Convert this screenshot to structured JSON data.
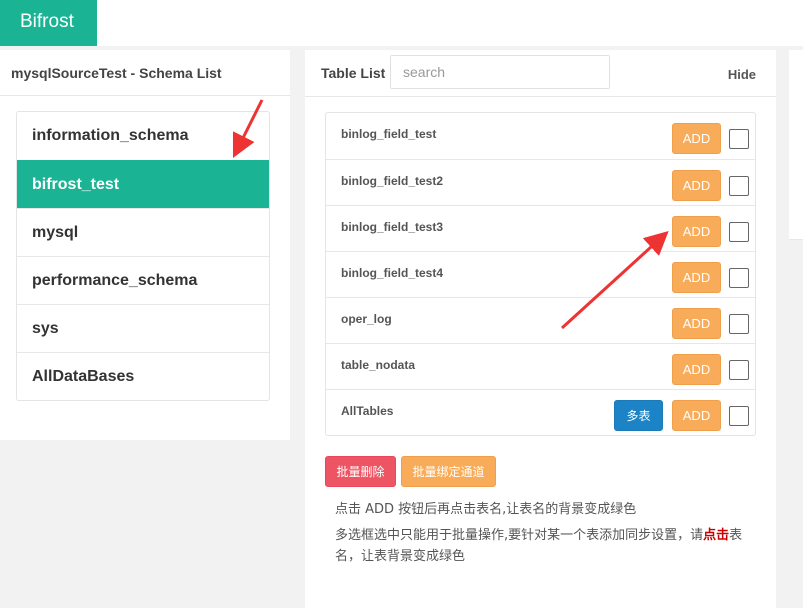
{
  "app": {
    "brand": "Bifrost"
  },
  "schema_panel": {
    "title": "mysqlSourceTest - Schema List",
    "items": [
      {
        "label": "information_schema",
        "active": false
      },
      {
        "label": "bifrost_test",
        "active": true
      },
      {
        "label": "mysql",
        "active": false
      },
      {
        "label": "performance_schema",
        "active": false
      },
      {
        "label": "sys",
        "active": false
      },
      {
        "label": "AllDataBases",
        "active": false
      }
    ]
  },
  "table_panel": {
    "title": "Table List",
    "search_placeholder": "search",
    "hide_label": "Hide",
    "add_label": "ADD",
    "multi_label": "多表",
    "rows": [
      {
        "name": "binlog_field_test"
      },
      {
        "name": "binlog_field_test2"
      },
      {
        "name": "binlog_field_test3"
      },
      {
        "name": "binlog_field_test4"
      },
      {
        "name": "oper_log"
      },
      {
        "name": "table_nodata"
      },
      {
        "name": "AllTables"
      }
    ],
    "batch_delete_label": "批量删除",
    "batch_bind_label": "批量绑定通道",
    "help_line1": "点击 ADD 按钮后再点击表名,让表名的背景变成绿色",
    "help_line2_pre": "多选框选中只能用于批量操作,要针对某一个表添加同步设置，请",
    "help_line2_highlight": "点击",
    "help_line2_post": "表名，让表背景变成绿色"
  },
  "colors": {
    "green": "#1ab394",
    "orange": "#f8ac59",
    "blue": "#1c84c6",
    "red": "#ed5565",
    "arrow": "#ee3333"
  }
}
